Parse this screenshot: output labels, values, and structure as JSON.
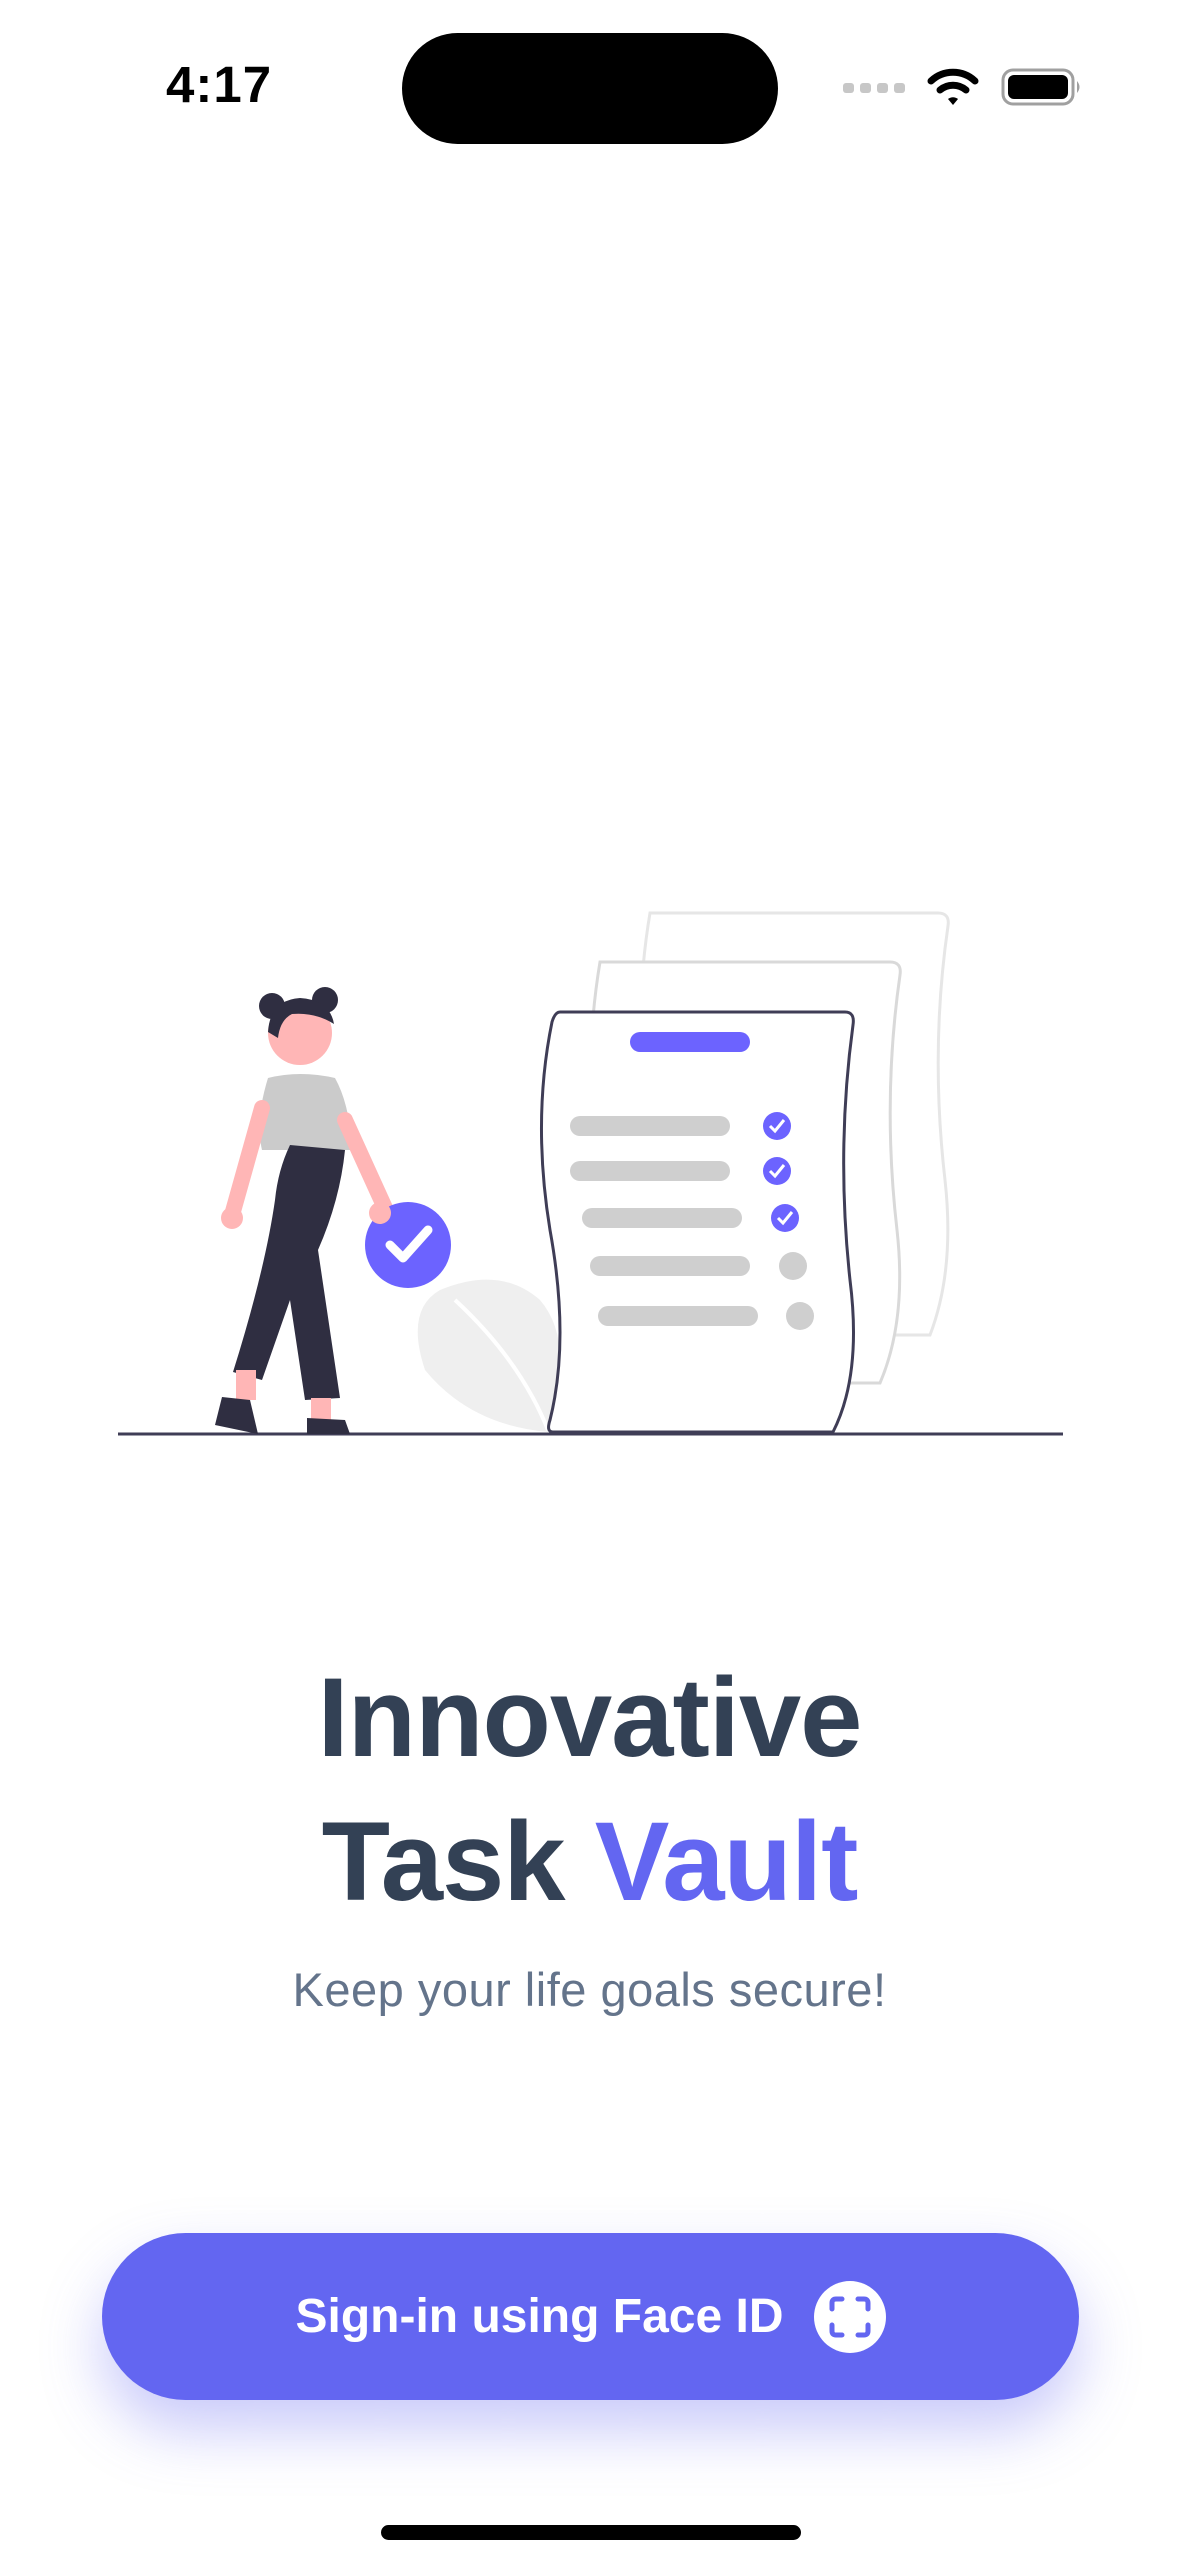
{
  "status_bar": {
    "time": "4:17"
  },
  "hero": {
    "title_line1": "Innovative",
    "title_line2_plain": "Task ",
    "title_line2_accent": "Vault",
    "subtitle": "Keep your life goals secure!"
  },
  "signin": {
    "label": "Sign-in using Face ID",
    "icon": "face-id-icon"
  },
  "colors": {
    "accent": "#6366f1",
    "title": "#334155",
    "subtitle": "#64748b",
    "background": "#ffffff"
  }
}
